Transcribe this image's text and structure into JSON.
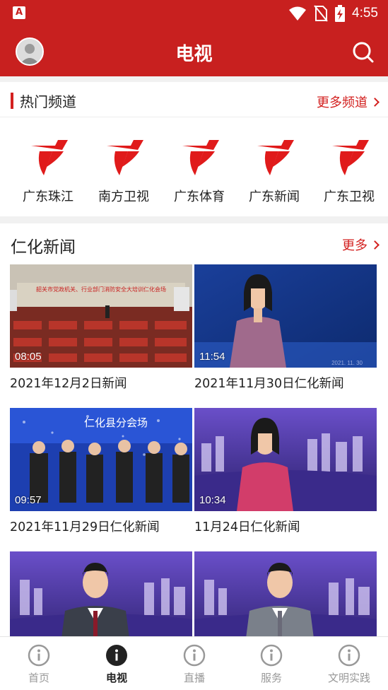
{
  "status_bar": {
    "time": "4:55",
    "app_icon_letter": "A",
    "icons": [
      "wifi-icon",
      "no-sim-icon",
      "battery-charging-icon"
    ]
  },
  "header": {
    "title": "电视",
    "avatar_icon": "avatar-icon",
    "search_icon": "search-icon"
  },
  "hot_channels": {
    "title": "热门频道",
    "more_label": "更多频道",
    "logo_color": "#e01b1b",
    "items": [
      {
        "label": "广东珠江"
      },
      {
        "label": "南方卫视"
      },
      {
        "label": "广东体育"
      },
      {
        "label": "广东新闻"
      },
      {
        "label": "广东卫视"
      }
    ]
  },
  "news": {
    "title": "仁化新闻",
    "more_label": "更多",
    "videos": [
      {
        "title": "2021年12月2日新闻",
        "duration": "08:05",
        "banner": "韶关市党政机关、行业部门消防安全大培训仁化会场"
      },
      {
        "title": "2021年11月30日仁化新闻",
        "duration": "11:54",
        "stamp": "2021. 11. 30"
      },
      {
        "title": "2021年11月29日仁化新闻",
        "duration": "09:57",
        "banner": "仁化县分会场"
      },
      {
        "title": "11月24日仁化新闻",
        "duration": "10:34"
      },
      {
        "title": "",
        "duration": ""
      },
      {
        "title": "",
        "duration": ""
      }
    ]
  },
  "tab_bar": {
    "active_index": 1,
    "items": [
      {
        "label": "首页",
        "icon": "info-icon"
      },
      {
        "label": "电视",
        "icon": "info-icon"
      },
      {
        "label": "直播",
        "icon": "info-icon"
      },
      {
        "label": "服务",
        "icon": "info-icon"
      },
      {
        "label": "文明实践",
        "icon": "info-icon"
      }
    ]
  },
  "colors": {
    "brand_red": "#c8201f",
    "accent_red": "#d3201f",
    "inactive_tab": "#999999"
  }
}
